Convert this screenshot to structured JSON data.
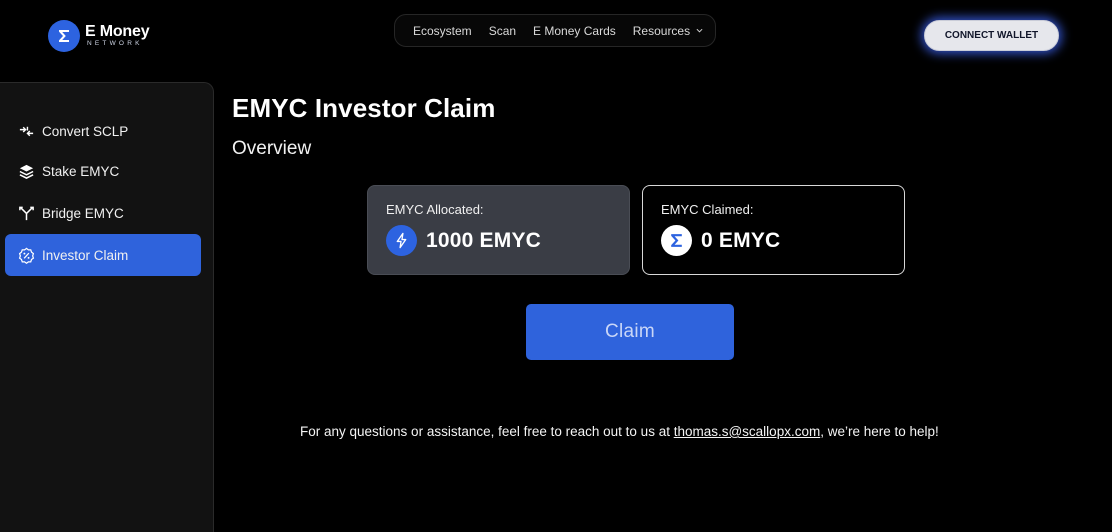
{
  "header": {
    "brand_name": "E Money",
    "brand_sub": "NETWORK",
    "nav": [
      {
        "label": "Ecosystem"
      },
      {
        "label": "Scan"
      },
      {
        "label": "E Money Cards"
      },
      {
        "label": "Resources"
      }
    ],
    "connect_label": "CONNECT WALLET"
  },
  "sidebar": {
    "items": [
      {
        "label": "Convert SCLP",
        "icon": "convert-icon",
        "active": false
      },
      {
        "label": "Stake EMYC",
        "icon": "layers-icon",
        "active": false
      },
      {
        "label": "Bridge EMYC",
        "icon": "bridge-icon",
        "active": false
      },
      {
        "label": "Investor Claim",
        "icon": "percent-badge-icon",
        "active": true
      }
    ]
  },
  "main": {
    "title": "EMYC Investor Claim",
    "subtitle": "Overview",
    "allocated": {
      "label": "EMYC Allocated:",
      "value": "1000 EMYC",
      "icon": "bolt-icon"
    },
    "claimed": {
      "label": "EMYC Claimed:",
      "value": "0 EMYC",
      "icon": "emoney-logo-icon"
    },
    "claim_label": "Claim",
    "footer": {
      "before": "For any questions or assistance, feel free to reach out to us at ",
      "email": "thomas.s@scallopx.com",
      "after": ", we’re here to help!"
    }
  },
  "colors": {
    "accent": "#2f63dc",
    "background": "#000000",
    "sidebar": "#121212",
    "card_allocated": "#3a3d45"
  }
}
